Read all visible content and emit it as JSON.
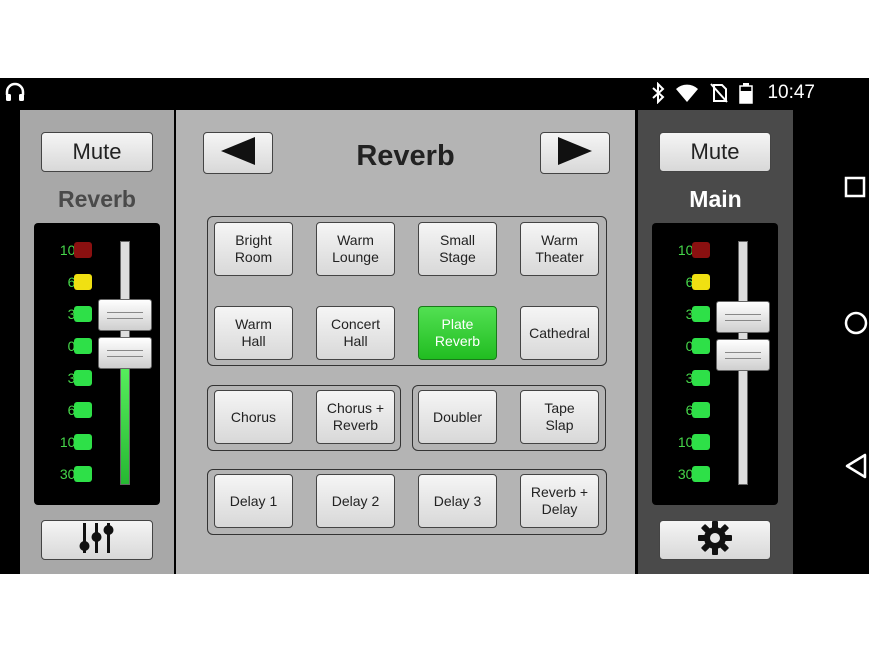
{
  "status": {
    "time": "10:47"
  },
  "left_channel": {
    "mute_label": "Mute",
    "name": "Reverb",
    "meter_ticks": [
      "10 -",
      "6 -",
      "3 -",
      "0 -",
      "3 -",
      "6 -",
      "10 -",
      "30 -"
    ],
    "level_fraction": 0.5,
    "bottom_icon": "sliders-icon"
  },
  "center": {
    "title": "Reverb",
    "prev_icon": "left-arrow-icon",
    "next_icon": "right-arrow-icon",
    "presets": {
      "reverbs": [
        "Bright\nRoom",
        "Warm\nLounge",
        "Small\nStage",
        "Warm\nTheater",
        "Warm\nHall",
        "Concert\nHall",
        "Plate\nReverb",
        "Cathedral"
      ],
      "chorus": [
        "Chorus",
        "Chorus +\nReverb"
      ],
      "doubler": [
        "Doubler",
        "Tape\nSlap"
      ],
      "delays": [
        "Delay 1",
        "Delay 2",
        "Delay 3",
        "Reverb +\nDelay"
      ]
    },
    "active_preset": "Plate Reverb"
  },
  "right_channel": {
    "mute_label": "Mute",
    "name": "Main",
    "meter_ticks": [
      "10 -",
      "6 -",
      "3 -",
      "0 -",
      "3 -",
      "6 -",
      "10 -",
      "30 -"
    ],
    "level_fraction": 0.0,
    "bottom_icon": "gear-icon"
  },
  "colors": {
    "active_green": "#2ec72e",
    "led_green": "#2ee048",
    "led_yellow": "#f0e012",
    "led_red": "#8a1010"
  }
}
